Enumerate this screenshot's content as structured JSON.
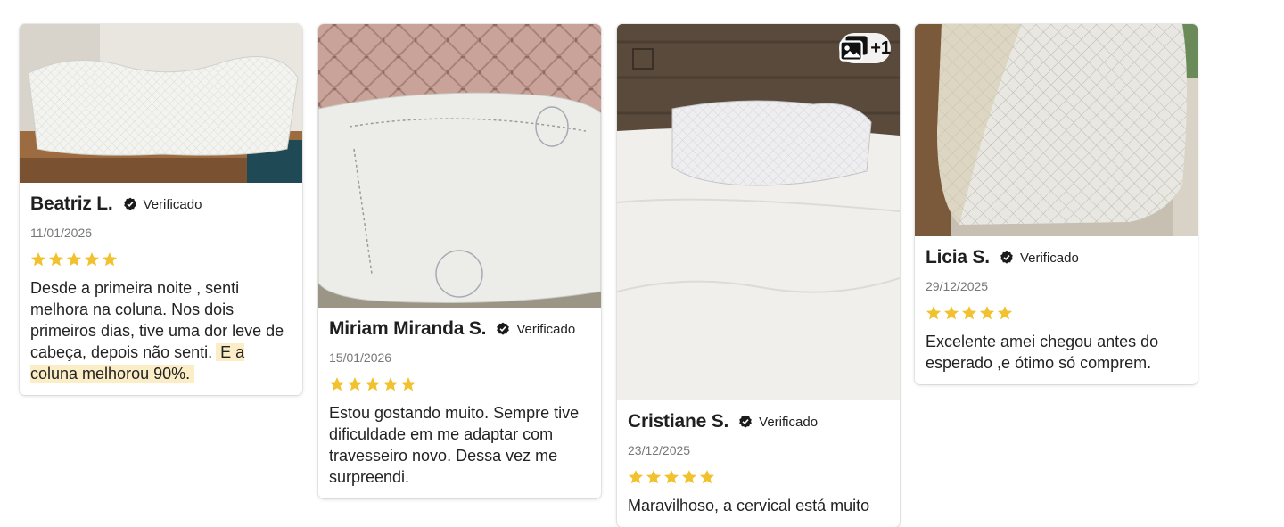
{
  "reviews": [
    {
      "name": "Beatriz L.",
      "verified_label": "Verificado",
      "date": "11/01/2026",
      "rating": 5,
      "text": "Desde a primeira noite , senti melhora na coluna. Nos dois primeiros dias, tive uma dor leve de cabeça, depois não senti.",
      "highlight": "E a coluna melhorou 90%.",
      "photo": "white-contour-pillow-on-shelf"
    },
    {
      "name": "Miriam Miranda S.",
      "verified_label": "Verificado",
      "date": "15/01/2026",
      "rating": 5,
      "text": "Estou gostando muito. Sempre tive dificuldade em me adaptar com travesseiro novo.  Dessa vez me surpreendi.",
      "photo": "pillow-against-pink-tufted-headboard"
    },
    {
      "name": "Cristiane S.",
      "verified_label": "Verificado",
      "date": "23/12/2025",
      "rating": 5,
      "text": "Maravilhoso, a cervical está muito",
      "photo": "contour-pillow-on-white-bed",
      "extra_photos_badge": "+1"
    },
    {
      "name": "Licia S.",
      "verified_label": "Verificado",
      "date": "29/12/2025",
      "rating": 5,
      "text": "Excelente amei chegou antes do esperado ,e ótimo só comprem.",
      "photo": "quilted-pillow-closeup"
    }
  ],
  "colors": {
    "star": "#f2c12e",
    "highlight": "#fbedc6",
    "date": "#777777"
  }
}
